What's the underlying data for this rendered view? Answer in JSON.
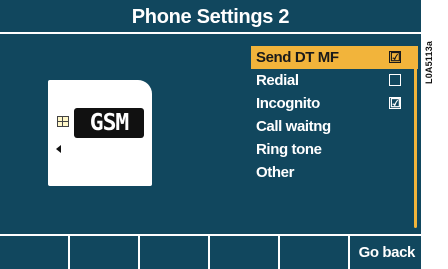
{
  "header": {
    "title": "Phone Settings 2"
  },
  "sim_card": {
    "logo_text": "GSM",
    "icon": "sim-card-icon"
  },
  "menu": {
    "items": [
      {
        "label": "Send DT MF",
        "checkbox": "☑",
        "selected": true
      },
      {
        "label": "Redial",
        "checkbox": "",
        "selected": false
      },
      {
        "label": "Incognito",
        "checkbox": "☑",
        "selected": false
      },
      {
        "label": "Call waitng",
        "selected": false
      },
      {
        "label": "Ring tone",
        "selected": false
      },
      {
        "label": "Other",
        "selected": false
      }
    ]
  },
  "softkeys": {
    "go_back": "Go back"
  },
  "side_label": "L0A5113a",
  "colors": {
    "screen_bg": "#11475e",
    "highlight": "#f2b43b",
    "text": "#ffffff"
  }
}
